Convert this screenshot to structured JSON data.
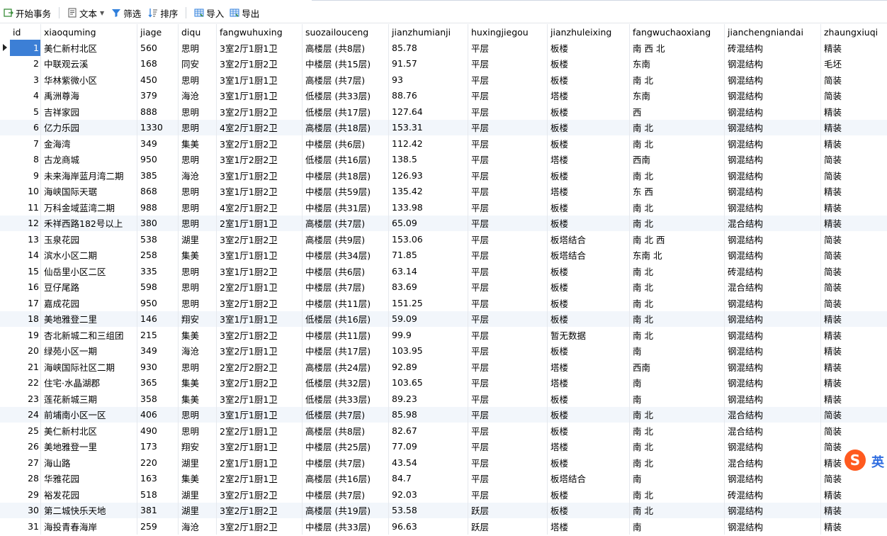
{
  "toolbar": {
    "begin_tx": "开始事务",
    "text": "文本",
    "filter": "筛选",
    "sort": "排序",
    "import": "导入",
    "export": "导出"
  },
  "columns": [
    "id",
    "xiaoquming",
    "jiage",
    "diqu",
    "fangwuhuxing",
    "suozailouceng",
    "jianzhumianji",
    "huxingjiegou",
    "jianzhuleixing",
    "fangwuchaoxiang",
    "jianchengniandai",
    "zhaungxiuqi"
  ],
  "rows": [
    [
      "1",
      "美仁新村北区",
      "560",
      "思明",
      "3室2厅1厨1卫",
      "高楼层 (共8层)",
      "85.78",
      "平层",
      "板楼",
      "南 西 北",
      "砖混结构",
      "精装"
    ],
    [
      "2",
      "中联观云溪",
      "168",
      "同安",
      "3室2厅1厨2卫",
      "中楼层 (共15层)",
      "91.57",
      "平层",
      "板楼",
      "东南",
      "钢混结构",
      "毛坯"
    ],
    [
      "3",
      "华林紫微小区",
      "450",
      "思明",
      "3室1厅1厨1卫",
      "高楼层 (共7层)",
      "93",
      "平层",
      "板楼",
      "南 北",
      "钢混结构",
      "简装"
    ],
    [
      "4",
      "禹洲尊海",
      "379",
      "海沧",
      "3室1厅1厨1卫",
      "低楼层 (共33层)",
      "88.76",
      "平层",
      "塔楼",
      "东南",
      "钢混结构",
      "简装"
    ],
    [
      "5",
      "吉祥家园",
      "888",
      "思明",
      "3室2厅1厨2卫",
      "低楼层 (共17层)",
      "127.64",
      "平层",
      "板楼",
      "西",
      "钢混结构",
      "精装"
    ],
    [
      "6",
      "亿力乐园",
      "1330",
      "思明",
      "4室2厅1厨2卫",
      "高楼层 (共18层)",
      "153.31",
      "平层",
      "板楼",
      "南 北",
      "钢混结构",
      "精装"
    ],
    [
      "7",
      "金海湾",
      "349",
      "集美",
      "3室2厅1厨2卫",
      "中楼层 (共6层)",
      "112.42",
      "平层",
      "板楼",
      "南 北",
      "钢混结构",
      "精装"
    ],
    [
      "8",
      "古龙商城",
      "950",
      "思明",
      "3室1厅2厨2卫",
      "低楼层 (共16层)",
      "138.5",
      "平层",
      "塔楼",
      "西南",
      "钢混结构",
      "简装"
    ],
    [
      "9",
      "未来海岸蓝月湾二期",
      "385",
      "海沧",
      "3室1厅1厨2卫",
      "中楼层 (共18层)",
      "126.93",
      "平层",
      "板楼",
      "南 北",
      "钢混结构",
      "简装"
    ],
    [
      "10",
      "海峡国际天琚",
      "868",
      "思明",
      "3室1厅1厨2卫",
      "中楼层 (共59层)",
      "135.42",
      "平层",
      "塔楼",
      "东 西",
      "钢混结构",
      "精装"
    ],
    [
      "11",
      "万科金域蓝湾二期",
      "988",
      "思明",
      "4室2厅1厨2卫",
      "中楼层 (共31层)",
      "133.98",
      "平层",
      "板楼",
      "南 北",
      "钢混结构",
      "精装"
    ],
    [
      "12",
      "禾祥西路182号以上",
      "380",
      "思明",
      "2室1厅1厨1卫",
      "高楼层 (共7层)",
      "65.09",
      "平层",
      "板楼",
      "南 北",
      "混合结构",
      "精装"
    ],
    [
      "13",
      "玉泉花园",
      "538",
      "湖里",
      "3室2厅1厨2卫",
      "高楼层 (共9层)",
      "153.06",
      "平层",
      "板塔结合",
      "南 北 西",
      "钢混结构",
      "简装"
    ],
    [
      "14",
      "滨水小区二期",
      "258",
      "集美",
      "3室1厅1厨1卫",
      "中楼层 (共34层)",
      "71.85",
      "平层",
      "板塔结合",
      "东南 北",
      "钢混结构",
      "简装"
    ],
    [
      "15",
      "仙岳里小区二区",
      "335",
      "思明",
      "3室1厅1厨2卫",
      "中楼层 (共6层)",
      "63.14",
      "平层",
      "板楼",
      "南 北",
      "砖混结构",
      "简装"
    ],
    [
      "16",
      "豆仔尾路",
      "598",
      "思明",
      "2室2厅1厨1卫",
      "中楼层 (共7层)",
      "83.69",
      "平层",
      "板楼",
      "南 北",
      "混合结构",
      "简装"
    ],
    [
      "17",
      "嘉成花园",
      "950",
      "思明",
      "3室2厅1厨2卫",
      "中楼层 (共11层)",
      "151.25",
      "平层",
      "板楼",
      "南 北",
      "钢混结构",
      "简装"
    ],
    [
      "18",
      "美地雅登二里",
      "146",
      "翔安",
      "3室1厅1厨1卫",
      "低楼层 (共16层)",
      "59.09",
      "平层",
      "板楼",
      "南 北",
      "钢混结构",
      "精装"
    ],
    [
      "19",
      "杏北新城二和三组团",
      "215",
      "集美",
      "3室2厅1厨2卫",
      "中楼层 (共11层)",
      "99.9",
      "平层",
      "暂无数据",
      "南 北",
      "钢混结构",
      "精装"
    ],
    [
      "20",
      "绿苑小区一期",
      "349",
      "海沧",
      "3室2厅1厨1卫",
      "中楼层 (共17层)",
      "103.95",
      "平层",
      "板楼",
      "南",
      "钢混结构",
      "精装"
    ],
    [
      "21",
      "海峡国际社区二期",
      "930",
      "思明",
      "2室2厅2厨2卫",
      "高楼层 (共24层)",
      "92.89",
      "平层",
      "塔楼",
      "西南",
      "钢混结构",
      "精装"
    ],
    [
      "22",
      "住宅·水晶湖郡",
      "365",
      "集美",
      "3室2厅1厨2卫",
      "低楼层 (共32层)",
      "103.65",
      "平层",
      "塔楼",
      "南",
      "钢混结构",
      "精装"
    ],
    [
      "23",
      "莲花新城三期",
      "358",
      "集美",
      "3室2厅1厨1卫",
      "低楼层 (共33层)",
      "89.23",
      "平层",
      "板楼",
      "南",
      "钢混结构",
      "精装"
    ],
    [
      "24",
      "前埔南小区一区",
      "406",
      "思明",
      "3室1厅1厨1卫",
      "低楼层 (共7层)",
      "85.98",
      "平层",
      "板楼",
      "南 北",
      "混合结构",
      "简装"
    ],
    [
      "25",
      "美仁新村北区",
      "490",
      "思明",
      "2室2厅1厨1卫",
      "高楼层 (共8层)",
      "82.67",
      "平层",
      "板楼",
      "南 北",
      "混合结构",
      "简装"
    ],
    [
      "26",
      "美地雅登一里",
      "173",
      "翔安",
      "3室2厅1厨1卫",
      "中楼层 (共25层)",
      "77.09",
      "平层",
      "塔楼",
      "南 北",
      "钢混结构",
      "简装"
    ],
    [
      "27",
      "海山路",
      "220",
      "湖里",
      "2室1厅1厨1卫",
      "中楼层 (共7层)",
      "43.54",
      "平层",
      "板楼",
      "南 北",
      "混合结构",
      "精装"
    ],
    [
      "28",
      "华雅花园",
      "163",
      "集美",
      "2室2厅1厨1卫",
      "高楼层 (共16层)",
      "84.7",
      "平层",
      "板塔结合",
      "南",
      "钢混结构",
      "简装"
    ],
    [
      "29",
      "裕发花园",
      "518",
      "湖里",
      "3室2厅1厨2卫",
      "中楼层 (共7层)",
      "92.03",
      "平层",
      "板楼",
      "南 北",
      "砖混结构",
      "精装"
    ],
    [
      "30",
      "第二城快乐天地",
      "381",
      "湖里",
      "3室2厅1厨2卫",
      "高楼层 (共19层)",
      "53.58",
      "跃层",
      "板楼",
      "南 北",
      "钢混结构",
      "精装"
    ],
    [
      "31",
      "海投青春海岸",
      "259",
      "海沧",
      "3室2厅1厨2卫",
      "中楼层 (共33层)",
      "96.63",
      "跃层",
      "塔楼",
      "南",
      "钢混结构",
      "精装"
    ]
  ],
  "ime": {
    "logo": "S",
    "label": "英"
  },
  "colors": {
    "selected": "#3c7fd6",
    "alt_row": "#f2f6fb",
    "accent": "#2f6de0"
  }
}
